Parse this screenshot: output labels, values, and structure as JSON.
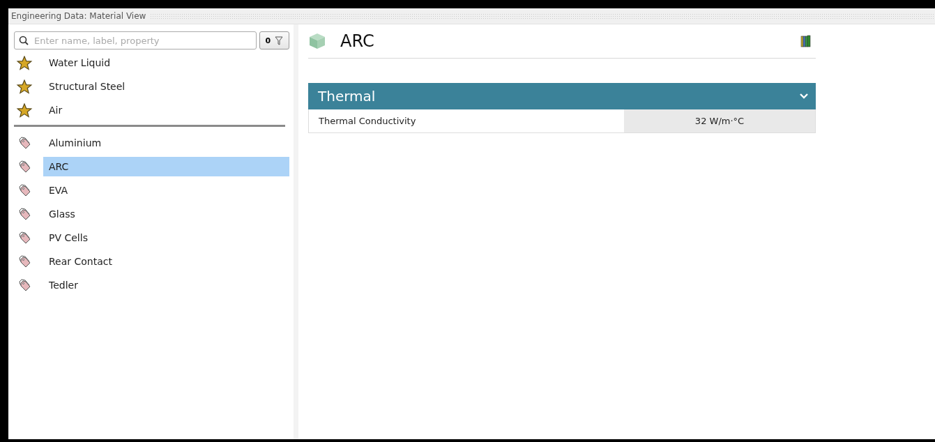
{
  "window": {
    "title": "Engineering Data: Material View"
  },
  "search": {
    "placeholder": "Enter name, label, property"
  },
  "filter_button": {
    "count": "0"
  },
  "favorites": [
    {
      "name": "Water Liquid",
      "selected": false
    },
    {
      "name": "Structural Steel",
      "selected": false
    },
    {
      "name": "Air",
      "selected": false
    }
  ],
  "materials": [
    {
      "name": "Aluminium",
      "selected": false
    },
    {
      "name": "ARC",
      "selected": true
    },
    {
      "name": "EVA",
      "selected": false
    },
    {
      "name": "Glass",
      "selected": false
    },
    {
      "name": "PV Cells",
      "selected": false
    },
    {
      "name": "Rear Contact",
      "selected": false
    },
    {
      "name": "Tedler",
      "selected": false
    }
  ],
  "detail": {
    "title": "ARC",
    "sections": [
      {
        "title": "Thermal",
        "expanded": true,
        "properties": [
          {
            "name": "Thermal Conductivity",
            "value": "32  W/m·°C"
          }
        ]
      }
    ]
  }
}
